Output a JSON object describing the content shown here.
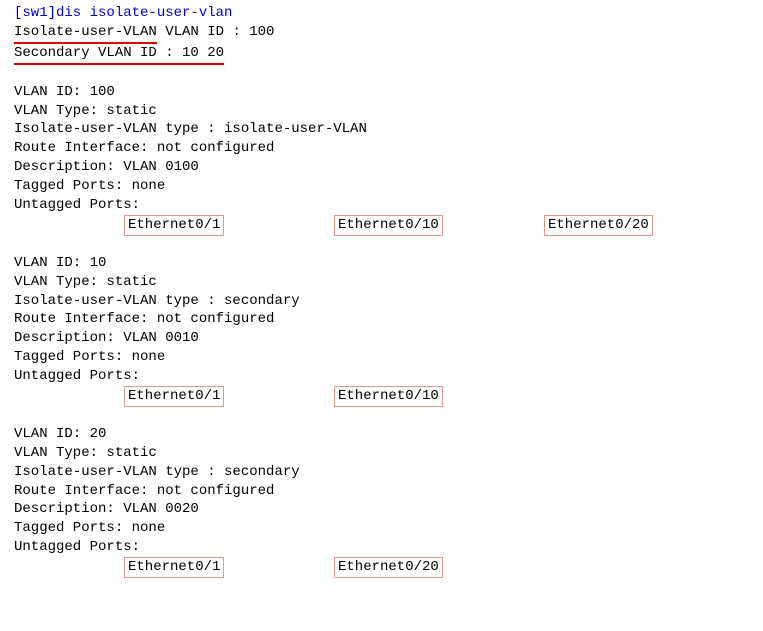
{
  "prompt": "[sw1]dis isolate-user-vlan",
  "header": {
    "line1_label": "Isolate-user-VLAN",
    "line1_rest": " VLAN ID : 100",
    "line2_label": "Secondary VLAN ID : 10 20"
  },
  "vlans": [
    {
      "id_line": "VLAN ID: 100",
      "type_line": "VLAN Type: static",
      "iuv_type_line": "Isolate-user-VLAN type : isolate-user-VLAN",
      "route_line": "Route Interface: not configured",
      "desc_line": "Description: VLAN 0100",
      "tagged_line": "Tagged   Ports: none",
      "untagged_line": "Untagged Ports:",
      "ports": [
        "Ethernet0/1",
        "Ethernet0/10",
        "Ethernet0/20"
      ]
    },
    {
      "id_line": "VLAN ID: 10",
      "type_line": "VLAN Type: static",
      "iuv_type_line": "Isolate-user-VLAN type : secondary",
      "route_line": "Route Interface: not configured",
      "desc_line": "Description: VLAN 0010",
      "tagged_line": "Tagged   Ports: none",
      "untagged_line": "Untagged Ports:",
      "ports": [
        "Ethernet0/1",
        "Ethernet0/10"
      ]
    },
    {
      "id_line": "VLAN ID: 20",
      "type_line": "VLAN Type: static",
      "iuv_type_line": "Isolate-user-VLAN type : secondary",
      "route_line": "Route Interface: not configured",
      "desc_line": "Description: VLAN 0020",
      "tagged_line": "Tagged   Ports: none",
      "untagged_line": "Untagged Ports:",
      "ports": [
        "Ethernet0/1",
        "Ethernet0/20"
      ]
    }
  ]
}
